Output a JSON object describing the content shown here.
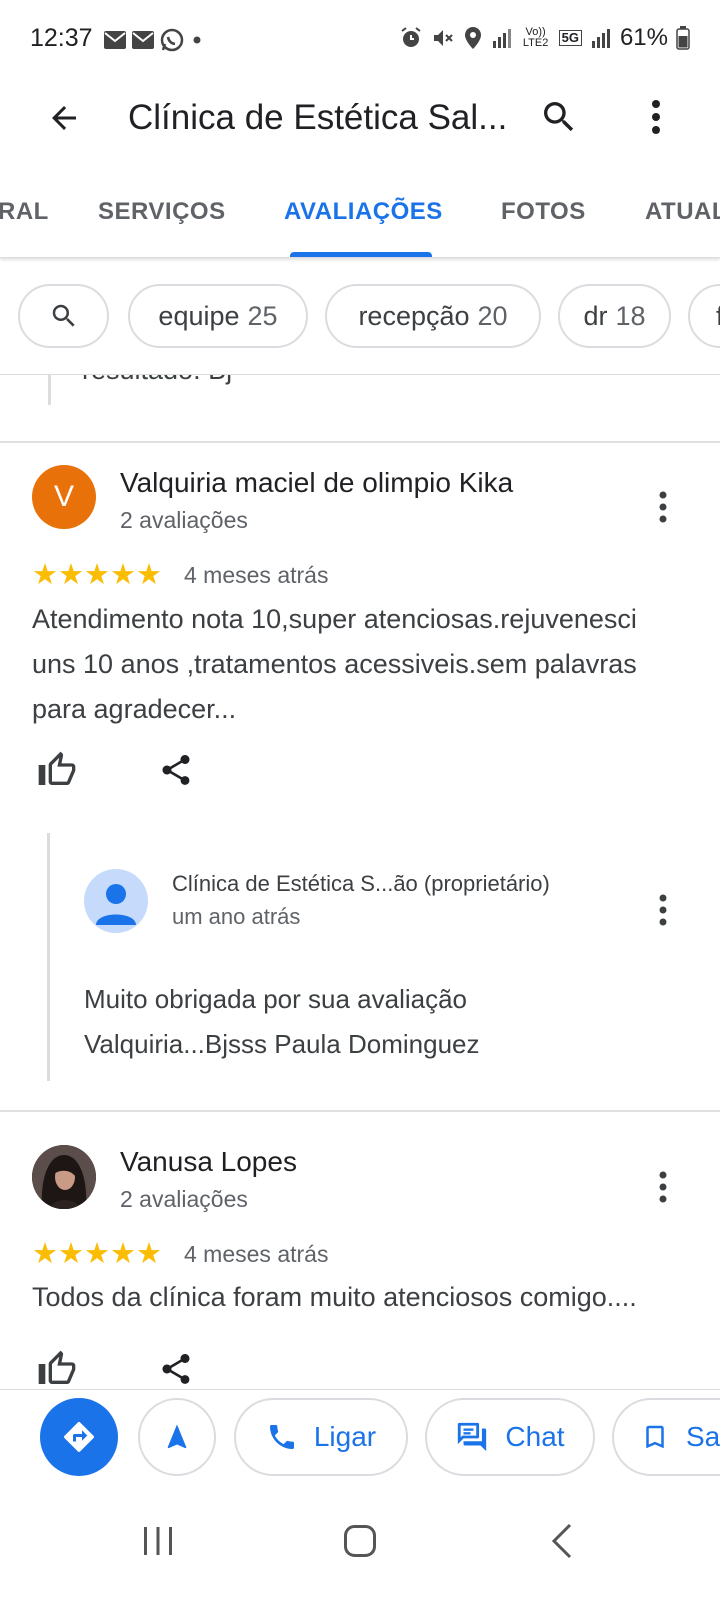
{
  "status_bar": {
    "time": "12:37",
    "battery": "61%",
    "left_icons": [
      "mail-icon",
      "mail-icon",
      "whatsapp-icon",
      "dot-icon"
    ],
    "right_icons": [
      "alarm-icon",
      "mute-icon",
      "location-icon",
      "signal-icon",
      "volte-icon",
      "5g-icon",
      "signal-icon",
      "battery-icon"
    ],
    "volte_label": "Vo)) LTE2",
    "fiveg_label": "5G"
  },
  "app_bar": {
    "title": "Clínica de Estética Sal...",
    "icons": [
      "back-arrow-icon",
      "search-icon",
      "more-vert-icon"
    ]
  },
  "tabs": [
    {
      "label": "RAL",
      "active": false
    },
    {
      "label": "SERVIÇOS",
      "active": false
    },
    {
      "label": "AVALIAÇÕES",
      "active": true
    },
    {
      "label": "FOTOS",
      "active": false
    },
    {
      "label": "ATUAL",
      "active": false
    }
  ],
  "chips": [
    {
      "label": "",
      "count": "",
      "icon": "search-icon"
    },
    {
      "label": "equipe",
      "count": "25"
    },
    {
      "label": "recepção",
      "count": "20"
    },
    {
      "label": "dr",
      "count": "18"
    },
    {
      "label": "f",
      "count": ""
    }
  ],
  "previous_review_snippet": "resultado. Bj",
  "reviews": [
    {
      "avatar_letter": "V",
      "avatar_color": "#e8710a",
      "name": "Valquiria maciel de olimpio Kika",
      "meta": "2 avaliações",
      "rating": 5,
      "stars": "★★★★★",
      "time": "4 meses atrás",
      "text": "Atendimento nota 10,super atenciosas.rejuvenesci uns 10 anos ,tratamentos acessiveis.sem palavras para agradecer...",
      "reply": {
        "owner": "Clínica de Estética S...ão (proprietário)",
        "time": "um ano atrás",
        "text": "Muito obrigada por sua avaliação Valquiria...Bjsss Paula Dominguez"
      }
    },
    {
      "name": "Vanusa Lopes",
      "meta": "2 avaliações",
      "rating": 5,
      "stars": "★★★★★",
      "time": "4 meses atrás",
      "text": "Todos da clínica foram muito atenciosos comigo...."
    }
  ],
  "bottom_actions": [
    {
      "icon": "directions-icon"
    },
    {
      "icon": "navigation-icon"
    },
    {
      "label": "Ligar",
      "icon": "phone-icon"
    },
    {
      "label": "Chat",
      "icon": "chat-icon"
    },
    {
      "label": "Sa",
      "icon": "bookmark-icon"
    }
  ],
  "nav_bar": [
    "recents-icon",
    "home-icon",
    "back-icon"
  ],
  "colors": {
    "accent": "#1a73e8",
    "star": "#fbbc04",
    "avatar_orange": "#e8710a",
    "text_primary": "#202124",
    "text_secondary": "#5f6368"
  }
}
